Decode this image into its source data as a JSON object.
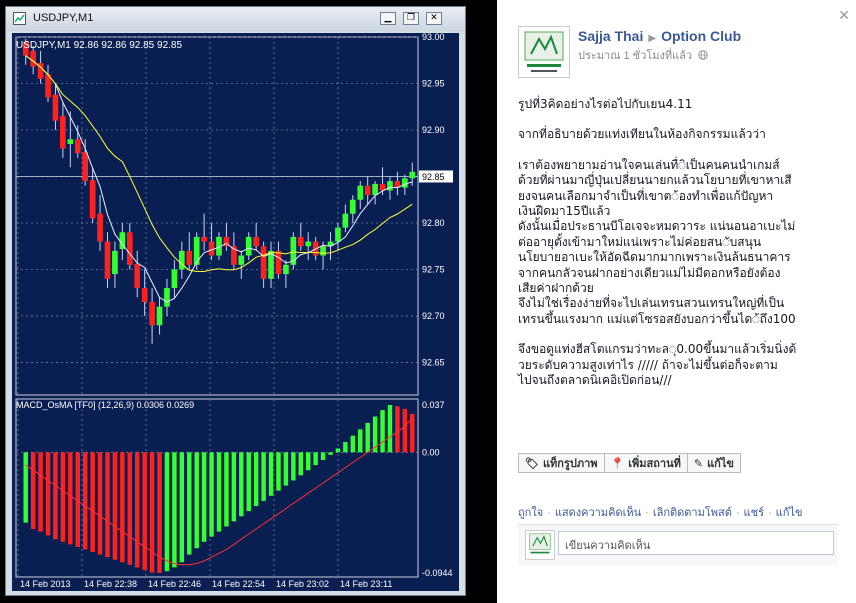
{
  "window": {
    "title": "USDJPY,M1"
  },
  "chart_data": [
    {
      "type": "candlestick",
      "header": "USDJPY,M1  92.86 92.86 92.85 92.85",
      "y_ticks": [
        "93.00",
        "92.95",
        "92.90",
        "92.85",
        "92.80",
        "92.75",
        "92.70",
        "92.65"
      ],
      "ylim": [
        92.615,
        93.0
      ],
      "current_price": "92.85",
      "x_ticks": [
        "14 Feb 2013",
        "14 Feb 22:38",
        "14 Feb 22:46",
        "14 Feb 22:54",
        "14 Feb 23:02",
        "14 Feb 23:11"
      ],
      "up_color": "#33ff33",
      "down_color": "#ff2020",
      "candles": [
        [
          92.995,
          92.998,
          92.97,
          92.98
        ],
        [
          92.985,
          92.99,
          92.96,
          92.968
        ],
        [
          92.972,
          92.985,
          92.95,
          92.955
        ],
        [
          92.96,
          92.97,
          92.93,
          92.935
        ],
        [
          92.938,
          92.95,
          92.9,
          92.91
        ],
        [
          92.915,
          92.93,
          92.87,
          92.88
        ],
        [
          92.885,
          92.92,
          92.86,
          92.89
        ],
        [
          92.89,
          92.905,
          92.87,
          92.875
        ],
        [
          92.876,
          92.89,
          92.84,
          92.845
        ],
        [
          92.846,
          92.86,
          92.8,
          92.805
        ],
        [
          92.81,
          92.83,
          92.77,
          92.78
        ],
        [
          92.78,
          92.79,
          92.73,
          92.74
        ],
        [
          92.745,
          92.78,
          92.73,
          92.77
        ],
        [
          92.772,
          92.8,
          92.76,
          92.79
        ],
        [
          92.79,
          92.8,
          92.75,
          92.755
        ],
        [
          92.756,
          92.77,
          92.72,
          92.73
        ],
        [
          92.73,
          92.75,
          92.7,
          92.715
        ],
        [
          92.715,
          92.73,
          92.67,
          92.69
        ],
        [
          92.69,
          92.72,
          92.68,
          92.71
        ],
        [
          92.71,
          92.74,
          92.7,
          92.73
        ],
        [
          92.73,
          92.76,
          92.72,
          92.75
        ],
        [
          92.75,
          92.78,
          92.74,
          92.77
        ],
        [
          92.77,
          92.79,
          92.75,
          92.755
        ],
        [
          92.755,
          92.79,
          92.75,
          92.785
        ],
        [
          92.785,
          92.81,
          92.77,
          92.78
        ],
        [
          92.78,
          92.8,
          92.76,
          92.765
        ],
        [
          92.765,
          92.79,
          92.76,
          92.785
        ],
        [
          92.785,
          92.8,
          92.77,
          92.775
        ],
        [
          92.775,
          92.79,
          92.75,
          92.755
        ],
        [
          92.755,
          92.77,
          92.74,
          92.765
        ],
        [
          92.765,
          92.79,
          92.76,
          92.785
        ],
        [
          92.785,
          92.8,
          92.77,
          92.775
        ],
        [
          92.775,
          92.78,
          92.73,
          92.74
        ],
        [
          92.74,
          92.78,
          92.73,
          92.77
        ],
        [
          92.77,
          92.78,
          92.74,
          92.745
        ],
        [
          92.745,
          92.76,
          92.73,
          92.755
        ],
        [
          92.755,
          92.79,
          92.75,
          92.785
        ],
        [
          92.785,
          92.8,
          92.77,
          92.775
        ],
        [
          92.775,
          92.79,
          92.76,
          92.78
        ],
        [
          92.78,
          92.785,
          92.76,
          92.765
        ],
        [
          92.765,
          92.78,
          92.75,
          92.775
        ],
        [
          92.775,
          92.79,
          92.76,
          92.78
        ],
        [
          92.78,
          92.8,
          92.77,
          92.795
        ],
        [
          92.795,
          92.82,
          92.79,
          92.81
        ],
        [
          92.81,
          92.83,
          92.8,
          92.825
        ],
        [
          92.825,
          92.845,
          92.815,
          92.84
        ],
        [
          92.84,
          92.85,
          92.82,
          92.83
        ],
        [
          92.83,
          92.845,
          92.82,
          92.842
        ],
        [
          92.842,
          92.86,
          92.83,
          92.835
        ],
        [
          92.835,
          92.85,
          92.825,
          92.845
        ],
        [
          92.845,
          92.855,
          92.83,
          92.838
        ],
        [
          92.838,
          92.852,
          92.83,
          92.848
        ],
        [
          92.848,
          92.865,
          92.84,
          92.855
        ]
      ]
    },
    {
      "type": "bar",
      "label": "MACD_OsMA [TF0] (12,26,9)  0.0306 0.0269",
      "y_ticks": [
        "0.037",
        "0.00",
        "-0.0944"
      ],
      "ylim": [
        -0.0944,
        0.037
      ],
      "values": [
        -0.055,
        -0.06,
        -0.062,
        -0.065,
        -0.068,
        -0.07,
        -0.072,
        -0.074,
        -0.076,
        -0.078,
        -0.08,
        -0.082,
        -0.084,
        -0.086,
        -0.088,
        -0.09,
        -0.092,
        -0.094,
        -0.0944,
        -0.093,
        -0.09,
        -0.086,
        -0.08,
        -0.075,
        -0.07,
        -0.066,
        -0.062,
        -0.058,
        -0.054,
        -0.05,
        -0.046,
        -0.042,
        -0.038,
        -0.034,
        -0.03,
        -0.026,
        -0.022,
        -0.018,
        -0.014,
        -0.01,
        -0.006,
        -0.002,
        0.003,
        0.008,
        0.013,
        0.018,
        0.023,
        0.028,
        0.033,
        0.037,
        0.036,
        0.034,
        0.03
      ],
      "signal": [
        -0.01,
        -0.014,
        -0.018,
        -0.022,
        -0.026,
        -0.03,
        -0.034,
        -0.038,
        -0.042,
        -0.046,
        -0.05,
        -0.054,
        -0.058,
        -0.062,
        -0.066,
        -0.07,
        -0.074,
        -0.078,
        -0.082,
        -0.085,
        -0.087,
        -0.088,
        -0.088,
        -0.087,
        -0.085,
        -0.082,
        -0.079,
        -0.076,
        -0.072,
        -0.068,
        -0.064,
        -0.06,
        -0.056,
        -0.052,
        -0.048,
        -0.044,
        -0.04,
        -0.036,
        -0.032,
        -0.028,
        -0.024,
        -0.02,
        -0.016,
        -0.012,
        -0.008,
        -0.004,
        0.0,
        0.004,
        0.008,
        0.012,
        0.016,
        0.02,
        0.027
      ]
    }
  ],
  "post": {
    "author": "Sajja Thai",
    "page": "Option Club",
    "time": "ประมาณ 1 ชั่วโมงที่แล้ว",
    "close_icon": "close-icon",
    "lines": [
      "รูปที่3คิดอย่างไรต่อไปกับเยน4.11",
      "",
      "จากที่อธิบายด้วยแท่งเทียนในห้องกิจกรรมแล้วว่า",
      "",
      "เราต้องพยายามอ่านใจคนเล่นทื่◌ิเป็นคนคนนำเกมส์",
      "ด้วยที่ผ่านมาญี่ปุ่นเปลี่ยนนายกแล้วนโยบายที่เขาหาเสี",
      "ยงจนคนเลือกมาจำเป็นที่เขาต◌้องทำเพื่อแก้ปัญหา",
      "เงินฝืดมา15ปีแล้ว",
      "ดังนั้นเมื่อประธานบีโอเจจะหมดวาระ แน่นอนอาเบะไม่",
      "ต่ออายุตั้งเข้ามาใหม่แน่เพราะไม่ค่อยสน◌ับสนุน",
      "นโยบายอาเบะให้อัดฉีดมากมากเพราะเงินล้นธนาคาร",
      "จากคนกลัวจนฝากอย่างเดียวแม่ไม่มีดอกหรือยังต้อง",
      "เสียค่าฝากด้วย",
      "จึงไม่ใช่เรื่องง่ายที่จะไปเล่นเทรนสวนเทรนใหญ่ที่เป็น",
      "เทรนขึ้นแรงมาก แม่แต่โซรอสยังบอกว่าขึ้นได◌้ถึง100",
      "",
      "จึงขอดูแท่งฮีสโตแกรมว่าทะล◌ุ0.00ขึ้นมาแล้วเริ่มนิ่งด้",
      "วยระดับความสูงเท่าไร ///// ถ้าจะไม่ขึ้นต่อก็จะตาม",
      "ไปจนถึงตลาดนิเคอิเปิดก่อน///"
    ],
    "actions": {
      "tag_photo": "แท็กรูปภาพ",
      "add_location": "เพิ่มสถานที่",
      "edit": "แก้ไข"
    },
    "links": [
      "ถูกใจ",
      "แสดงความคิดเห็น",
      "เลิกติดตามโพสต์",
      "แชร์",
      "แก้ไข"
    ],
    "comment_placeholder": "เขียนความคิดเห็น"
  }
}
